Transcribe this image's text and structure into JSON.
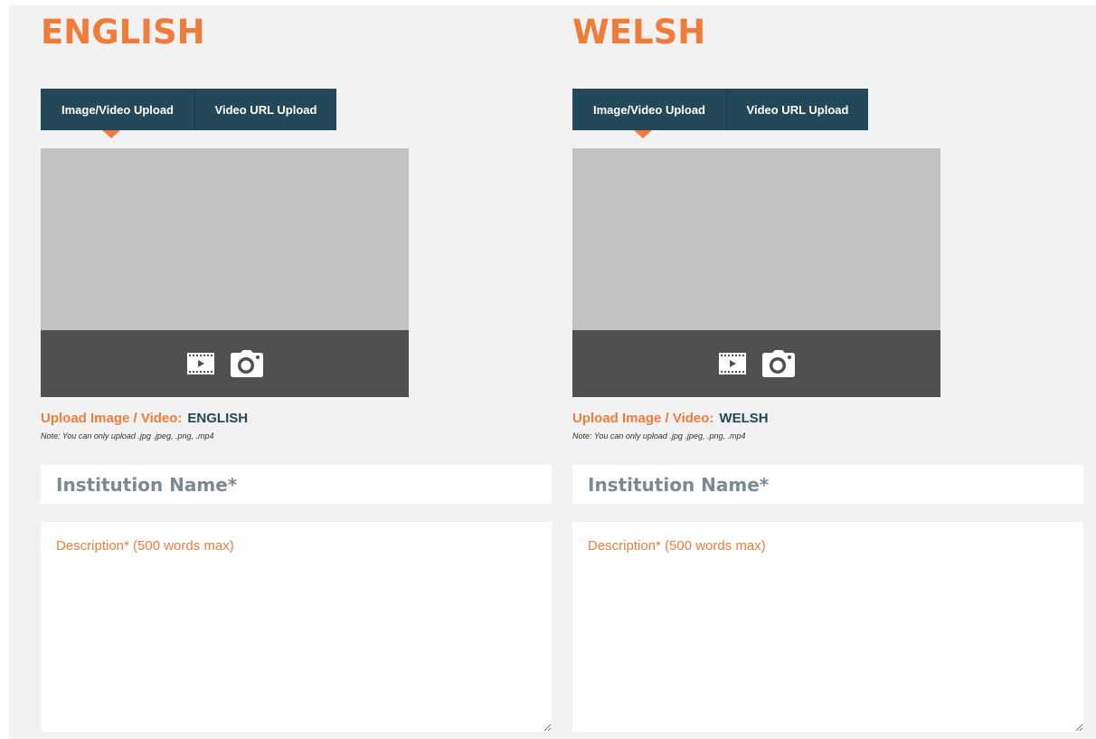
{
  "colors": {
    "accent": "#f07c3c",
    "tab_bg": "#234857",
    "preview_bg": "#c2c2c2",
    "media_bar": "#505050",
    "panel_bg": "#f2f2f2"
  },
  "english": {
    "title": "ENGLISH",
    "tabs": [
      {
        "label": "Image/Video Upload",
        "active": true
      },
      {
        "label": "Video URL Upload",
        "active": false
      }
    ],
    "icons": [
      "film-icon",
      "camera-icon"
    ],
    "upload_label": "Upload Image / Video:",
    "upload_lang": "ENGLISH",
    "note": "Note: You can only upload .jpg .jpeg, .png, .mp4",
    "institution_placeholder": "Institution Name*",
    "description_placeholder": "Description* (500 words max)"
  },
  "welsh": {
    "title": "WELSH",
    "tabs": [
      {
        "label": "Image/Video Upload",
        "active": true
      },
      {
        "label": "Video URL Upload",
        "active": false
      }
    ],
    "icons": [
      "film-icon",
      "camera-icon"
    ],
    "upload_label": "Upload Image / Video:",
    "upload_lang": "WELSH",
    "note": "Note: You can only upload .jpg .jpeg, .png, .mp4",
    "institution_placeholder": "Institution Name*",
    "description_placeholder": "Description* (500 words max)"
  }
}
